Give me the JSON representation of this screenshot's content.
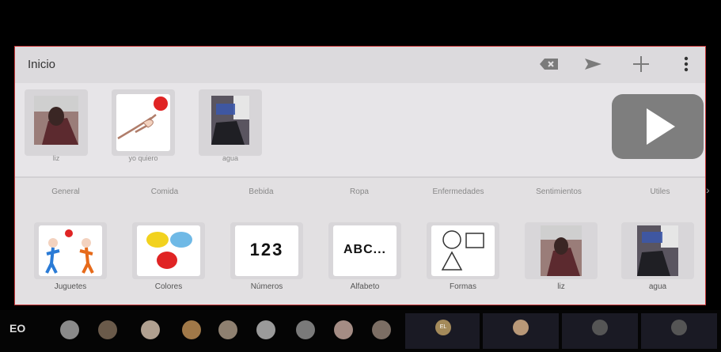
{
  "header": {
    "title": "Inicio"
  },
  "sentence": {
    "items": [
      {
        "label": "liz"
      },
      {
        "label": "yo quiero"
      },
      {
        "label": "agua"
      }
    ]
  },
  "tabs": [
    "General",
    "Comida",
    "Bebida",
    "Ropa",
    "Enfermedades",
    "Sentimientos",
    "Utiles"
  ],
  "grid": {
    "cards": [
      {
        "label": "Juguetes",
        "pict": ""
      },
      {
        "label": "Colores",
        "pict": ""
      },
      {
        "label": "Números",
        "pict": "123"
      },
      {
        "label": "Alfabeto",
        "pict": "ABC..."
      },
      {
        "label": "Formas",
        "pict": ""
      },
      {
        "label": "liz",
        "pict": ""
      },
      {
        "label": "agua",
        "pict": ""
      }
    ]
  },
  "callbar": {
    "left_text": "EO",
    "initials": "EL"
  },
  "colors": {
    "frame_border": "#c8383a",
    "play_bg": "#7e7e7e",
    "red_ball": "#e02424"
  }
}
